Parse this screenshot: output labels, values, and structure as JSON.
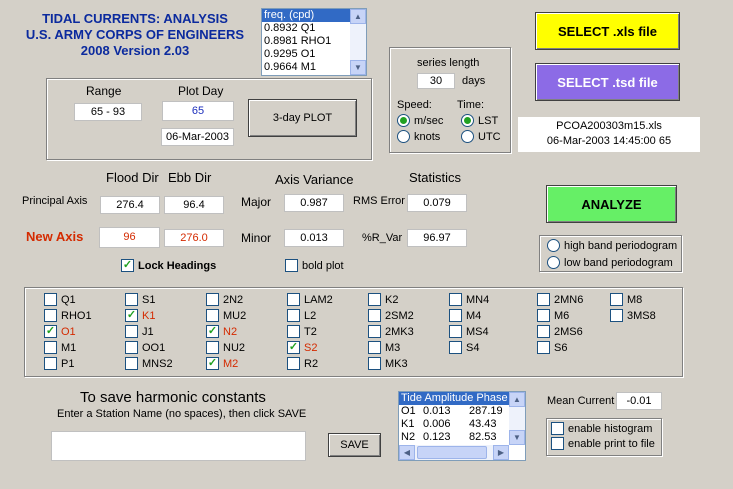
{
  "header": {
    "line1": "TIDAL CURRENTS: ANALYSIS",
    "line2": "U.S. ARMY CORPS OF ENGINEERS",
    "line3": "2008 Version 2.03"
  },
  "freq_list": {
    "header": "freq. (cpd)",
    "rows": [
      "0.8932   Q1",
      "0.8981  RHO1",
      "0.9295   O1",
      "0.9664   M1"
    ]
  },
  "select_xls_label": "SELECT .xls file",
  "select_tsd_label": "SELECT .tsd file",
  "range": {
    "label": "Range",
    "value": "65 - 93"
  },
  "plot_day": {
    "label": "Plot Day",
    "value": "65",
    "date": "06-Mar-2003"
  },
  "plot_button": "3-day PLOT",
  "series": {
    "label": "series length",
    "value": "30",
    "unit": "days"
  },
  "speed": {
    "label": "Speed:",
    "opt1": "m/sec",
    "opt2": "knots",
    "selected": "m/sec"
  },
  "time": {
    "label": "Time:",
    "opt1": "LST",
    "opt2": "UTC",
    "selected": "LST"
  },
  "file_info": {
    "name": "PCOA200303m15.xls",
    "datetime": "06-Mar-2003 14:45:00 65"
  },
  "flood_dir_label": "Flood Dir",
  "ebb_dir_label": "Ebb Dir",
  "axis_variance_label": "Axis Variance",
  "statistics_label": "Statistics",
  "principal_axis": {
    "label": "Principal Axis",
    "flood": "276.4",
    "ebb": "96.4"
  },
  "new_axis": {
    "label": "New Axis",
    "flood": "96",
    "ebb": "276.0"
  },
  "major": {
    "label": "Major",
    "value": "0.987"
  },
  "minor": {
    "label": "Minor",
    "value": "0.013"
  },
  "rms": {
    "label": "RMS Error",
    "value": "0.079"
  },
  "rvar": {
    "label": "%R_Var",
    "value": "96.97"
  },
  "analyze_label": "ANALYZE",
  "periodogram": {
    "high": "high band periodogram",
    "low": "low band periodogram"
  },
  "lock_headings": {
    "label": "Lock Headings",
    "checked": true
  },
  "bold_plot": {
    "label": "bold plot",
    "checked": false
  },
  "constituents": [
    [
      {
        "n": "Q1",
        "c": false
      },
      {
        "n": "RHO1",
        "c": false
      },
      {
        "n": "O1",
        "c": true,
        "red": true
      },
      {
        "n": "M1",
        "c": false
      },
      {
        "n": "P1",
        "c": false
      }
    ],
    [
      {
        "n": "S1",
        "c": false
      },
      {
        "n": "K1",
        "c": true,
        "red": true
      },
      {
        "n": "J1",
        "c": false
      },
      {
        "n": "OO1",
        "c": false
      },
      {
        "n": "MNS2",
        "c": false
      }
    ],
    [
      {
        "n": "2N2",
        "c": false
      },
      {
        "n": "MU2",
        "c": false
      },
      {
        "n": "N2",
        "c": true,
        "red": true
      },
      {
        "n": "NU2",
        "c": false
      },
      {
        "n": "M2",
        "c": true,
        "red": true
      }
    ],
    [
      {
        "n": "LAM2",
        "c": false
      },
      {
        "n": "L2",
        "c": false
      },
      {
        "n": "T2",
        "c": false
      },
      {
        "n": "S2",
        "c": true,
        "red": true
      },
      {
        "n": "R2",
        "c": false
      }
    ],
    [
      {
        "n": "K2",
        "c": false
      },
      {
        "n": "2SM2",
        "c": false
      },
      {
        "n": "2MK3",
        "c": false
      },
      {
        "n": "M3",
        "c": false
      },
      {
        "n": "MK3",
        "c": false
      }
    ],
    [
      {
        "n": "MN4",
        "c": false
      },
      {
        "n": "M4",
        "c": false
      },
      {
        "n": "MS4",
        "c": false
      },
      {
        "n": "S4",
        "c": false
      }
    ],
    [
      {
        "n": "2MN6",
        "c": false
      },
      {
        "n": "M6",
        "c": false
      },
      {
        "n": "2MS6",
        "c": false
      },
      {
        "n": "S6",
        "c": false
      }
    ],
    [
      {
        "n": "M8",
        "c": false
      },
      {
        "n": "3MS8",
        "c": false
      }
    ]
  ],
  "save_title": "To save harmonic constants",
  "save_instr": "Enter a Station Name (no spaces), then click SAVE",
  "station_name_value": "",
  "save_label": "SAVE",
  "tide_table": {
    "header": "Tide  Amplitude  Phase",
    "rows": [
      {
        "n": "O1",
        "a": "0.013",
        "p": "287.19"
      },
      {
        "n": "K1",
        "a": "0.006",
        "p": "43.43"
      },
      {
        "n": "N2",
        "a": "0.123",
        "p": "82.53"
      }
    ]
  },
  "mean_current": {
    "label": "Mean Current",
    "value": "-0.01"
  },
  "histogram": {
    "label": "enable histogram",
    "checked": false
  },
  "print_file": {
    "label": "enable print to file",
    "checked": false
  },
  "colors": {
    "background": "#d4d0c8",
    "header_blue": "#0b2a9e",
    "xls_yellow": "#ffff00",
    "tsd_purple": "#8c6be6",
    "analyze_green": "#66ef66",
    "new_axis_red": "#d42a00"
  }
}
